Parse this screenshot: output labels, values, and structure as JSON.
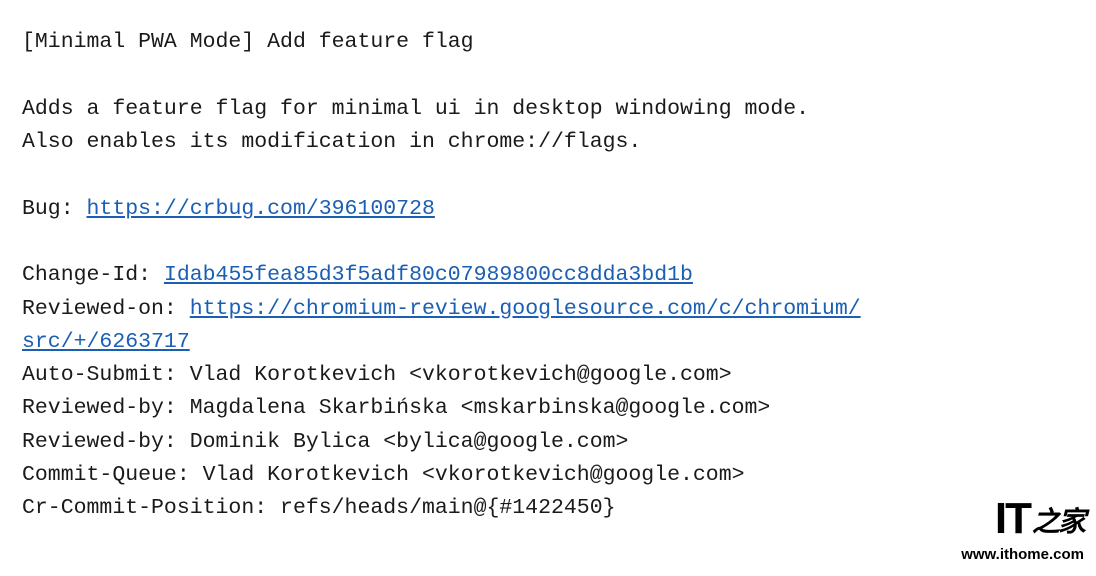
{
  "commit": {
    "title": "[Minimal PWA Mode] Add feature flag",
    "body_line1": "Adds a feature flag for minimal ui in desktop windowing mode.",
    "body_line2": "Also enables its modification in chrome://flags.",
    "bug_label": "Bug: ",
    "bug_url": "https://crbug.com/396100728",
    "change_id_label": "Change-Id: ",
    "change_id_value": "Idab455fea85d3f5adf80c07989800cc8dda3bd1b",
    "reviewed_on_label": "Reviewed-on: ",
    "reviewed_on_url_part1": "https://chromium-review.googlesource.com/c/chromium/",
    "reviewed_on_url_part2": "src/+/6263717",
    "auto_submit": "Auto-Submit: Vlad Korotkevich <vkorotkevich@google.com>",
    "reviewed_by_1": "Reviewed-by: Magdalena Skarbińska <mskarbinska@google.com>",
    "reviewed_by_2": "Reviewed-by: Dominik Bylica <bylica@google.com>",
    "commit_queue": "Commit-Queue: Vlad Korotkevich <vkorotkevich@google.com>",
    "cr_commit_position": "Cr-Commit-Position: refs/heads/main@{#1422450}"
  },
  "watermark": {
    "logo_text": "IT",
    "logo_suffix": "之家",
    "url": "www.ithome.com"
  }
}
